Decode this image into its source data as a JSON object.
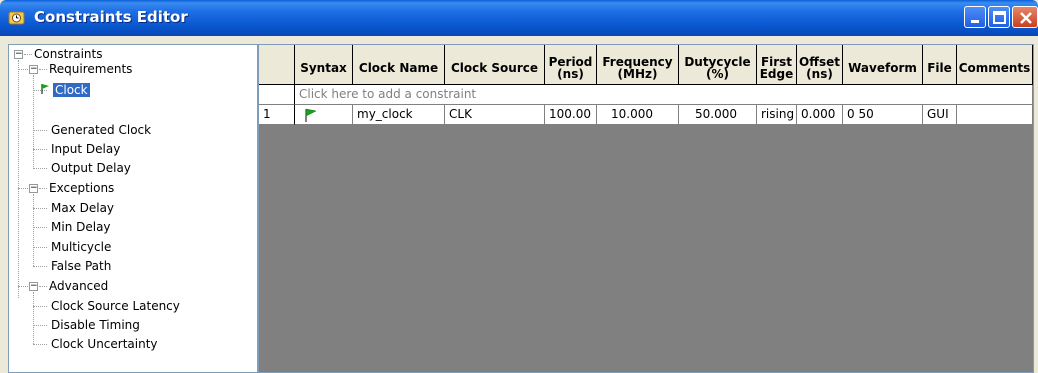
{
  "window": {
    "title": "Constraints Editor"
  },
  "colors": {
    "titlebar": "#0a58d0",
    "selection": "#316ac5",
    "panel_bg": "#ece9d8",
    "grid_bg": "#808080",
    "flag": "#1aa01a"
  },
  "tree": {
    "root": "Constraints",
    "groups": [
      {
        "label": "Requirements",
        "items": [
          "Clock",
          "Generated Clock",
          "Input Delay",
          "Output Delay"
        ]
      },
      {
        "label": "Exceptions",
        "items": [
          "Max Delay",
          "Min Delay",
          "Multicycle",
          "False Path"
        ]
      },
      {
        "label": "Advanced",
        "items": [
          "Clock Source Latency",
          "Disable Timing",
          "Clock Uncertainty"
        ]
      }
    ],
    "selected": "Clock"
  },
  "table": {
    "columns": [
      {
        "line1": "",
        "line2": ""
      },
      {
        "line1": "Syntax",
        "line2": ""
      },
      {
        "line1": "Clock Name",
        "line2": ""
      },
      {
        "line1": "Clock Source",
        "line2": ""
      },
      {
        "line1": "Period",
        "line2": "(ns)"
      },
      {
        "line1": "Frequency",
        "line2": "(MHz)"
      },
      {
        "line1": "Dutycycle",
        "line2": "(%)"
      },
      {
        "line1": "First",
        "line2": "Edge"
      },
      {
        "line1": "Offset",
        "line2": "(ns)"
      },
      {
        "line1": "Waveform",
        "line2": ""
      },
      {
        "line1": "File",
        "line2": ""
      },
      {
        "line1": "Comments",
        "line2": ""
      }
    ],
    "add_row_text": "Click here to add a constraint",
    "rows": [
      {
        "num": "1",
        "syntax_icon": "green-flag-icon",
        "clock_name": "my_clock",
        "clock_source": "CLK",
        "period": "100.00",
        "frequency": "10.000",
        "dutycycle": "50.000",
        "first_edge": "rising",
        "offset": "0.000",
        "waveform": "0 50",
        "file": "GUI",
        "comments": ""
      }
    ]
  }
}
